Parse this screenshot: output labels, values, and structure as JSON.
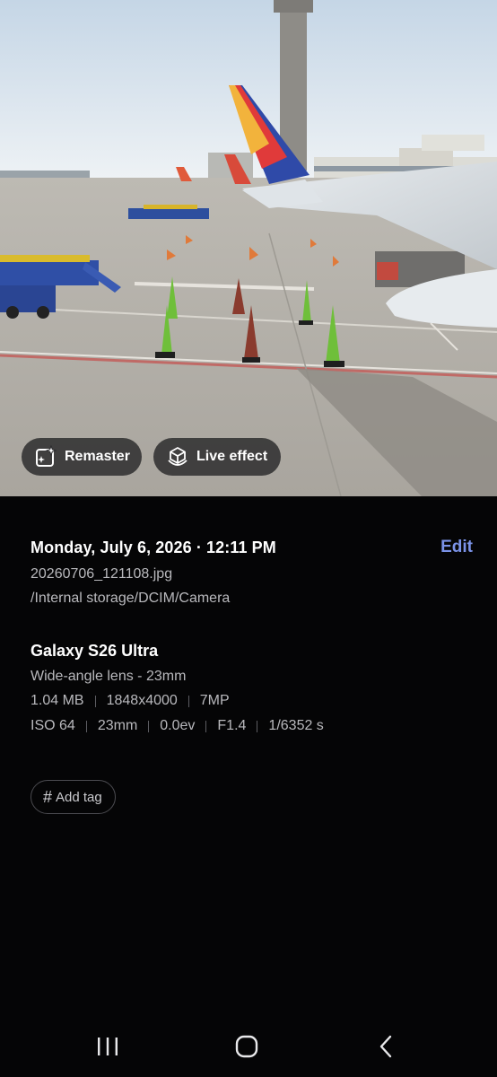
{
  "photo": {
    "description_icon_names": [
      "remaster-sparkle-icon",
      "live-effect-cube-icon"
    ],
    "chips": {
      "remaster_label": "Remaster",
      "live_effect_label": "Live effect"
    }
  },
  "details": {
    "datetime": "Monday, July 6, 2026 · 12:11 PM",
    "edit_label": "Edit",
    "filename": "20260706_121108.jpg",
    "path": "/Internal storage/DCIM/Camera",
    "device": "Galaxy S26 Ultra",
    "lens": "Wide-angle lens - 23mm",
    "file_info": [
      "1.04 MB",
      "1848x4000",
      "7MP"
    ],
    "exposure_info": [
      "ISO 64",
      "23mm",
      "0.0ev",
      "F1.4",
      "1/6352 s"
    ],
    "add_tag_label": "Add tag"
  },
  "colors": {
    "background": "#050506",
    "accent_edit": "#7b93e8",
    "secondary_text": "#b9b9bd"
  },
  "navbar": {
    "icons": [
      "recents-icon",
      "home-icon",
      "back-icon"
    ]
  }
}
